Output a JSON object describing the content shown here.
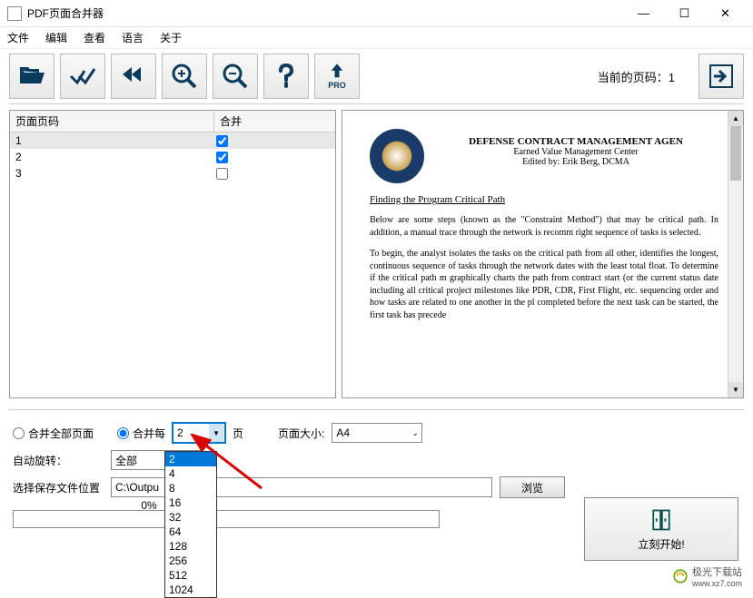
{
  "titlebar": {
    "title": "PDF页面合并器"
  },
  "menubar": {
    "file": "文件",
    "edit": "编辑",
    "view": "查看",
    "language": "语言",
    "about": "关于"
  },
  "toolbar": {
    "pro": "PRO",
    "status": "当前的页码：1"
  },
  "table": {
    "header_page": "页面页码",
    "header_merge": "合并",
    "rows": [
      {
        "page": "1",
        "checked": true
      },
      {
        "page": "2",
        "checked": true
      },
      {
        "page": "3",
        "checked": false
      }
    ]
  },
  "preview": {
    "title": "DEFENSE CONTRACT MANAGEMENT AGEN",
    "sub1": "Earned Value Management Center",
    "sub2": "Edited by: Erik Berg, DCMA",
    "heading": "Finding the Program Critical Path",
    "para1": "Below are some steps (known as the \"Constraint Method\") that may be critical path. In addition, a manual trace through the network is recomm right sequence of tasks is selected.",
    "para2": "To begin, the analyst isolates the tasks on the critical path from all other, identifies the longest, continuous sequence of tasks through the network dates with the least total float. To determine if the critical path m graphically charts the path from contract start (or the current status date including all critical project milestones like PDR, CDR, First Flight, etc. sequencing order and how tasks are related to one another in the pl completed before the next task can be started, the first task has precede"
  },
  "controls": {
    "merge_all_label": "合并全部页面",
    "merge_every_label": "合并每",
    "merge_every_value": "2",
    "pages_suffix": "页",
    "pagesize_label": "页面大小:",
    "pagesize_value": "A4",
    "rotate_label": "自动旋转：",
    "rotate_value": "全部",
    "output_label": "选择保存文件位置",
    "output_path": "C:\\Outpu",
    "browse": "浏览",
    "progress": "0%",
    "start": "立刻开始!"
  },
  "dropdown": {
    "items": [
      "2",
      "4",
      "8",
      "16",
      "32",
      "64",
      "128",
      "256",
      "512",
      "1024"
    ],
    "selected": "2"
  },
  "watermark": {
    "text": "极光下载站",
    "url": "www.xz7.com"
  }
}
